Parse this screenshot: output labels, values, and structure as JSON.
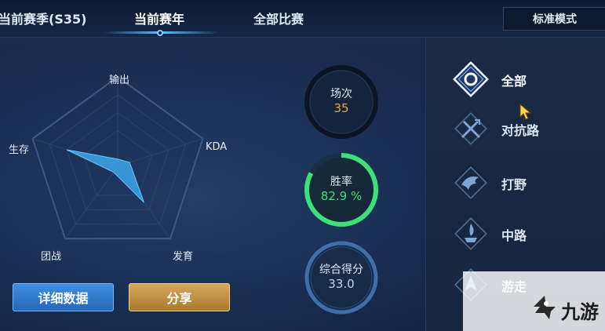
{
  "tabs": {
    "season": "当前赛季(S35)",
    "year": "当前赛年",
    "all": "全部比赛"
  },
  "mode_button": "标准模式",
  "radar": {
    "axes": [
      "输出",
      "KDA",
      "发育",
      "团战",
      "生存"
    ],
    "values": [
      0.08,
      0.14,
      0.5,
      0.08,
      0.6
    ],
    "fill_color": "#3aa0e0"
  },
  "stats": {
    "matches": {
      "label": "场次",
      "value": "35",
      "color": "#e8a84a"
    },
    "winrate": {
      "label": "胜率",
      "value": "82.9 %",
      "color": "#3ee07a",
      "ring_fraction": 0.829
    },
    "score": {
      "label": "综合得分",
      "value": "33.0",
      "color": "#bcd7f2"
    }
  },
  "buttons": {
    "detail": "详细数据",
    "share": "分享"
  },
  "roles": [
    {
      "label": "全部",
      "icon": "all-role-icon",
      "active": true
    },
    {
      "label": "对抗路",
      "icon": "clash-lane-icon",
      "active": false
    },
    {
      "label": "打野",
      "icon": "jungle-icon",
      "active": false
    },
    {
      "label": "中路",
      "icon": "mid-lane-icon",
      "active": false
    },
    {
      "label": "游走",
      "icon": "roam-icon",
      "active": false
    }
  ],
  "watermark": {
    "text": "九游",
    "logo_icon": "jiuyou-logo-icon"
  }
}
